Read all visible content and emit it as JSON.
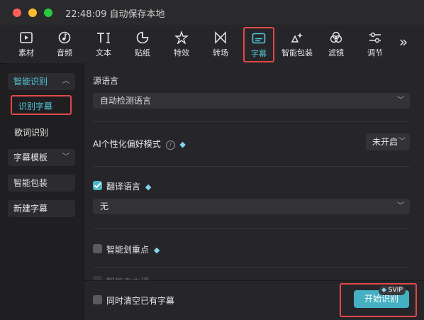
{
  "window": {
    "title": "22:48:09 自动保存本地"
  },
  "toolbar": {
    "items": [
      {
        "label": "素材",
        "icon": "media-icon"
      },
      {
        "label": "音频",
        "icon": "audio-icon"
      },
      {
        "label": "文本",
        "icon": "text-icon"
      },
      {
        "label": "贴纸",
        "icon": "sticker-icon"
      },
      {
        "label": "特效",
        "icon": "effects-icon"
      },
      {
        "label": "转场",
        "icon": "transition-icon"
      },
      {
        "label": "字幕",
        "icon": "subtitle-icon"
      },
      {
        "label": "智能包装",
        "icon": "smart-pack-icon"
      },
      {
        "label": "滤镜",
        "icon": "filter-icon"
      },
      {
        "label": "调节",
        "icon": "adjust-icon"
      }
    ],
    "more": "»"
  },
  "sidebar": {
    "group1": "智能识别",
    "active_item": "识别字幕",
    "item_lyrics": "歌词识别",
    "group2": "字幕模板",
    "item_pack": "智能包装",
    "item_new": "新建字幕"
  },
  "main": {
    "source_lang_label": "源语言",
    "source_lang_value": "自动检测语言",
    "ai_pref_label": "AI个性化偏好模式",
    "ai_pref_value": "未开启",
    "translate_label": "翻译语言",
    "translate_value": "无",
    "highlight_label": "智能划重点",
    "partial_label": "智能去水词"
  },
  "footer": {
    "clear_label": "同时清空已有字幕",
    "start_button": "开始识别",
    "svip_badge": "SVIP"
  },
  "colors": {
    "accent": "#52c8d8",
    "highlight_border": "#e24848"
  }
}
